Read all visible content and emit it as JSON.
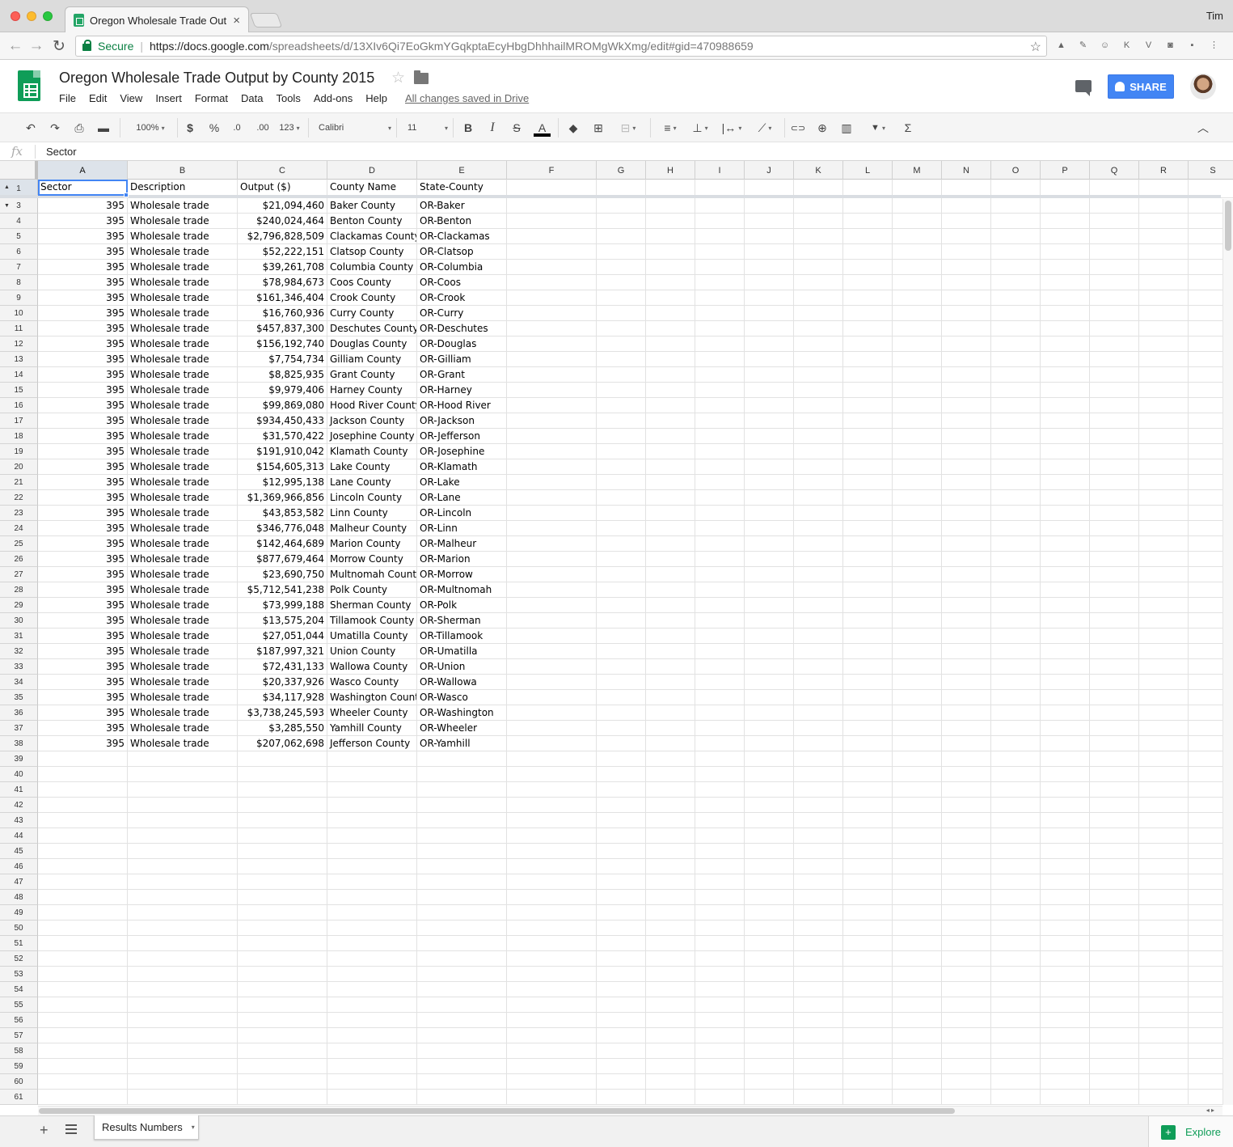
{
  "browser": {
    "tab_title": "Oregon Wholesale Trade Outp",
    "tab_close": "×",
    "user": "Tim",
    "secure_label": "Secure",
    "url_host": "https://docs.google.com",
    "url_path": "/spreadsheets/d/13XIv6Qi7EoGkmYGqkptaEcyHbgDhhhailMROMgWkXmg/edit#gid=470988659",
    "back": "←",
    "forward": "→",
    "reload": "↻",
    "bookmark_star": "☆"
  },
  "doc": {
    "title": "Oregon Wholesale Trade Output by County 2015",
    "star": "☆",
    "menu": [
      "File",
      "Edit",
      "View",
      "Insert",
      "Format",
      "Data",
      "Tools",
      "Add-ons",
      "Help"
    ],
    "saved_status": "All changes saved in Drive",
    "share_label": "SHARE"
  },
  "toolbar": {
    "undo": "↶",
    "redo": "↷",
    "print": "⎙",
    "paint": "▬",
    "zoom": "100%",
    "currency": "$",
    "percent": "%",
    "dec_less": ".0",
    "dec_more": ".00",
    "more_formats": "123",
    "font": "Calibri",
    "font_size": "11",
    "bold": "B",
    "italic": "I",
    "strike": "S",
    "text_color": "A",
    "fill": "◆",
    "borders": "⊞",
    "merge": "⊟",
    "halign": "≡",
    "valign": "⊥",
    "wrap": "|↔",
    "rotate": "⟋",
    "link": "⊂⊃",
    "comment": "⊕",
    "chart": "▥",
    "filter": "▼",
    "functions": "Σ",
    "collapse": "︿",
    "caret": "▾"
  },
  "formula_bar": {
    "fx": "fx",
    "value": "Sector"
  },
  "grid": {
    "columns": [
      "A",
      "B",
      "C",
      "D",
      "E",
      "F",
      "G",
      "H",
      "I",
      "J",
      "K",
      "L",
      "M",
      "N",
      "O",
      "P",
      "Q",
      "R",
      "S"
    ],
    "header_row_number": "1",
    "header": [
      "Sector",
      "Description",
      "Output ($)",
      "County Name",
      "State-County"
    ],
    "rows": [
      [
        "3",
        "395",
        "Wholesale trade",
        "$21,094,460",
        "Baker County",
        "OR-Baker"
      ],
      [
        "4",
        "395",
        "Wholesale trade",
        "$240,024,464",
        "Benton County",
        "OR-Benton"
      ],
      [
        "5",
        "395",
        "Wholesale trade",
        "$2,796,828,509",
        "Clackamas County",
        "OR-Clackamas"
      ],
      [
        "6",
        "395",
        "Wholesale trade",
        "$52,222,151",
        "Clatsop County",
        "OR-Clatsop"
      ],
      [
        "7",
        "395",
        "Wholesale trade",
        "$39,261,708",
        "Columbia County",
        "OR-Columbia"
      ],
      [
        "8",
        "395",
        "Wholesale trade",
        "$78,984,673",
        "Coos County",
        "OR-Coos"
      ],
      [
        "9",
        "395",
        "Wholesale trade",
        "$161,346,404",
        "Crook County",
        "OR-Crook"
      ],
      [
        "10",
        "395",
        "Wholesale trade",
        "$16,760,936",
        "Curry County",
        "OR-Curry"
      ],
      [
        "11",
        "395",
        "Wholesale trade",
        "$457,837,300",
        "Deschutes County",
        "OR-Deschutes"
      ],
      [
        "12",
        "395",
        "Wholesale trade",
        "$156,192,740",
        "Douglas County",
        "OR-Douglas"
      ],
      [
        "13",
        "395",
        "Wholesale trade",
        "$7,754,734",
        "Gilliam County",
        "OR-Gilliam"
      ],
      [
        "14",
        "395",
        "Wholesale trade",
        "$8,825,935",
        "Grant County",
        "OR-Grant"
      ],
      [
        "15",
        "395",
        "Wholesale trade",
        "$9,979,406",
        "Harney County",
        "OR-Harney"
      ],
      [
        "16",
        "395",
        "Wholesale trade",
        "$99,869,080",
        "Hood River County",
        "OR-Hood River"
      ],
      [
        "17",
        "395",
        "Wholesale trade",
        "$934,450,433",
        "Jackson County",
        "OR-Jackson"
      ],
      [
        "18",
        "395",
        "Wholesale trade",
        "$31,570,422",
        "Josephine County",
        "OR-Jefferson"
      ],
      [
        "19",
        "395",
        "Wholesale trade",
        "$191,910,042",
        "Klamath County",
        "OR-Josephine"
      ],
      [
        "20",
        "395",
        "Wholesale trade",
        "$154,605,313",
        "Lake County",
        "OR-Klamath"
      ],
      [
        "21",
        "395",
        "Wholesale trade",
        "$12,995,138",
        "Lane County",
        "OR-Lake"
      ],
      [
        "22",
        "395",
        "Wholesale trade",
        "$1,369,966,856",
        "Lincoln County",
        "OR-Lane"
      ],
      [
        "23",
        "395",
        "Wholesale trade",
        "$43,853,582",
        "Linn County",
        "OR-Lincoln"
      ],
      [
        "24",
        "395",
        "Wholesale trade",
        "$346,776,048",
        "Malheur County",
        "OR-Linn"
      ],
      [
        "25",
        "395",
        "Wholesale trade",
        "$142,464,689",
        "Marion County",
        "OR-Malheur"
      ],
      [
        "26",
        "395",
        "Wholesale trade",
        "$877,679,464",
        "Morrow County",
        "OR-Marion"
      ],
      [
        "27",
        "395",
        "Wholesale trade",
        "$23,690,750",
        "Multnomah County",
        "OR-Morrow"
      ],
      [
        "28",
        "395",
        "Wholesale trade",
        "$5,712,541,238",
        "Polk County",
        "OR-Multnomah"
      ],
      [
        "29",
        "395",
        "Wholesale trade",
        "$73,999,188",
        "Sherman County",
        "OR-Polk"
      ],
      [
        "30",
        "395",
        "Wholesale trade",
        "$13,575,204",
        "Tillamook County",
        "OR-Sherman"
      ],
      [
        "31",
        "395",
        "Wholesale trade",
        "$27,051,044",
        "Umatilla County",
        "OR-Tillamook"
      ],
      [
        "32",
        "395",
        "Wholesale trade",
        "$187,997,321",
        "Union County",
        "OR-Umatilla"
      ],
      [
        "33",
        "395",
        "Wholesale trade",
        "$72,431,133",
        "Wallowa County",
        "OR-Union"
      ],
      [
        "34",
        "395",
        "Wholesale trade",
        "$20,337,926",
        "Wasco County",
        "OR-Wallowa"
      ],
      [
        "35",
        "395",
        "Wholesale trade",
        "$34,117,928",
        "Washington County",
        "OR-Wasco"
      ],
      [
        "36",
        "395",
        "Wholesale trade",
        "$3,738,245,593",
        "Wheeler County",
        "OR-Washington"
      ],
      [
        "37",
        "395",
        "Wholesale trade",
        "$3,285,550",
        "Yamhill County",
        "OR-Wheeler"
      ],
      [
        "38",
        "395",
        "Wholesale trade",
        "$207,062,698",
        "Jefferson County",
        "OR-Yamhill"
      ]
    ],
    "empty_rows": [
      "39",
      "40",
      "41",
      "42",
      "43",
      "44",
      "45",
      "46",
      "47",
      "48",
      "49",
      "50",
      "51",
      "52",
      "53",
      "54",
      "55",
      "56",
      "57",
      "58",
      "59",
      "60",
      "61"
    ]
  },
  "bottom": {
    "add_sheet": "+",
    "sheet_tab": "Results Numbers",
    "explore_label": "Explore",
    "explore_icon": "+"
  },
  "colors": {
    "accent": "#4285f4",
    "sheets_green": "#0f9d58",
    "secure_green": "#0b8043"
  }
}
